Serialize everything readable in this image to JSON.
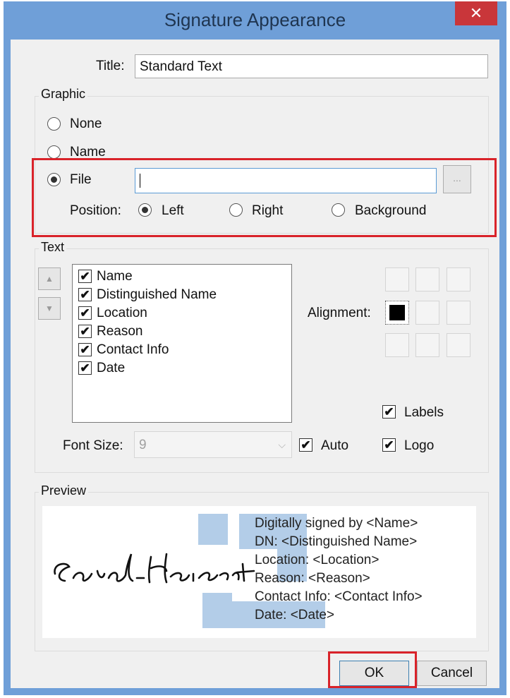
{
  "window": {
    "title": "Signature Appearance",
    "close_glyph": "✕"
  },
  "title_field": {
    "label": "Title:",
    "value": "Standard Text"
  },
  "graphic": {
    "group_label": "Graphic",
    "options": [
      {
        "label": "None",
        "selected": false
      },
      {
        "label": "Name",
        "selected": false
      },
      {
        "label": "File",
        "selected": true
      }
    ],
    "file_value": "",
    "browse_label": "...",
    "position_label": "Position:",
    "positions": [
      {
        "label": "Left",
        "selected": true
      },
      {
        "label": "Right",
        "selected": false
      },
      {
        "label": "Background",
        "selected": false
      }
    ]
  },
  "text": {
    "group_label": "Text",
    "move_up_glyph": "▲",
    "move_down_glyph": "▼",
    "items": [
      {
        "label": "Name",
        "checked": true
      },
      {
        "label": "Distinguished Name",
        "checked": true
      },
      {
        "label": "Location",
        "checked": true
      },
      {
        "label": "Reason",
        "checked": true
      },
      {
        "label": "Contact Info",
        "checked": true
      },
      {
        "label": "Date",
        "checked": true
      }
    ],
    "alignment_label": "Alignment:",
    "alignment_selected": "middle-left",
    "labels_checkbox": {
      "label": "Labels",
      "checked": true
    },
    "logo_checkbox": {
      "label": "Logo",
      "checked": true
    },
    "font_size_label": "Font Size:",
    "font_size_value": "9",
    "auto_checkbox": {
      "label": "Auto",
      "checked": true
    },
    "check_glyph": "✔"
  },
  "preview": {
    "group_label": "Preview",
    "signature_text": "Sarah Heinsohn",
    "lines": [
      "Digitally signed by <Name>",
      "DN: <Distinguished Name>",
      "Location: <Location>",
      "Reason: <Reason>",
      "Contact Info: <Contact Info>",
      "Date: <Date>"
    ]
  },
  "buttons": {
    "ok": "OK",
    "cancel": "Cancel"
  },
  "colors": {
    "highlight_red": "#d9232a",
    "titlebar": "#6f9fd8",
    "close": "#c9363a",
    "logo": "#b3cde8"
  }
}
